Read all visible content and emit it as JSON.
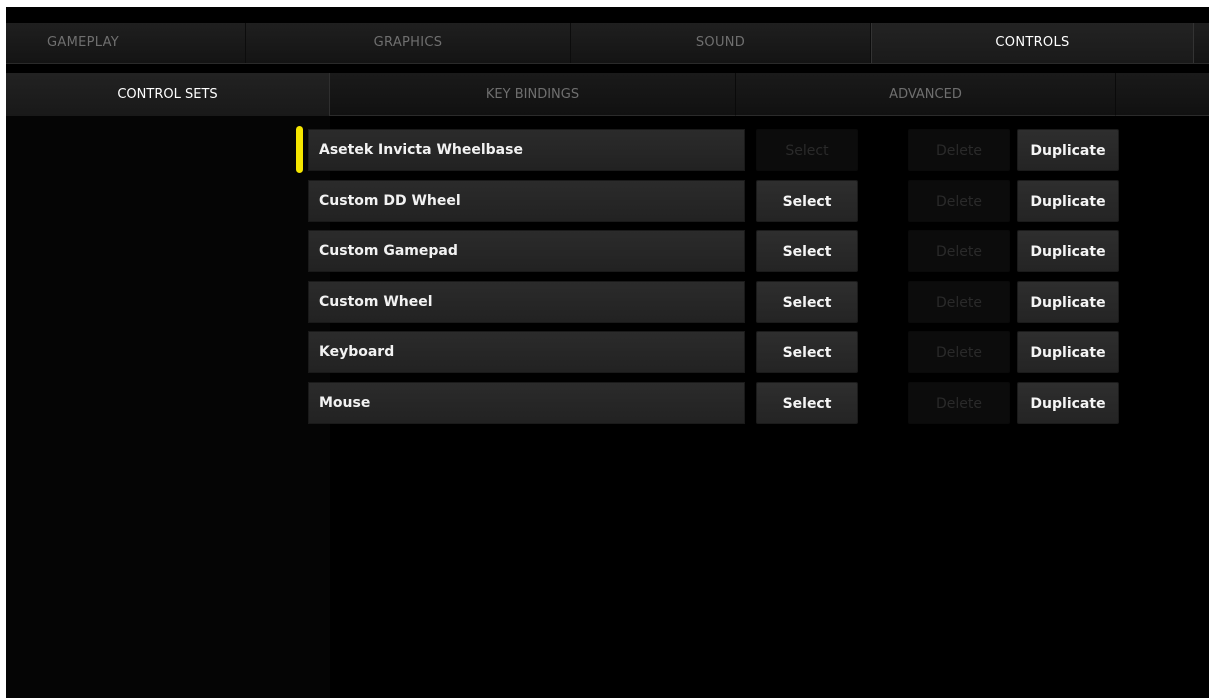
{
  "top_tabs": [
    "GAMEPLAY",
    "GRAPHICS",
    "SOUND",
    "CONTROLS",
    ""
  ],
  "active_top_tab": "CONTROLS",
  "sub_tabs": [
    "CONTROL SETS",
    "KEY BINDINGS",
    "ADVANCED",
    ""
  ],
  "active_sub_tab": "CONTROL SETS",
  "accent_color": "#f5e600",
  "control_sets": [
    {
      "name": "Asetek Invicta Wheelbase",
      "select": "Select",
      "select_enabled": false,
      "delete": "Delete",
      "delete_enabled": false,
      "duplicate": "Duplicate",
      "active": true
    },
    {
      "name": "Custom DD Wheel",
      "select": "Select",
      "select_enabled": true,
      "delete": "Delete",
      "delete_enabled": false,
      "duplicate": "Duplicate",
      "active": false
    },
    {
      "name": "Custom Gamepad",
      "select": "Select",
      "select_enabled": true,
      "delete": "Delete",
      "delete_enabled": false,
      "duplicate": "Duplicate",
      "active": false
    },
    {
      "name": "Custom Wheel",
      "select": "Select",
      "select_enabled": true,
      "delete": "Delete",
      "delete_enabled": false,
      "duplicate": "Duplicate",
      "active": false
    },
    {
      "name": "Keyboard",
      "select": "Select",
      "select_enabled": true,
      "delete": "Delete",
      "delete_enabled": false,
      "duplicate": "Duplicate",
      "active": false
    },
    {
      "name": "Mouse",
      "select": "Select",
      "select_enabled": true,
      "delete": "Delete",
      "delete_enabled": false,
      "duplicate": "Duplicate",
      "active": false
    }
  ]
}
